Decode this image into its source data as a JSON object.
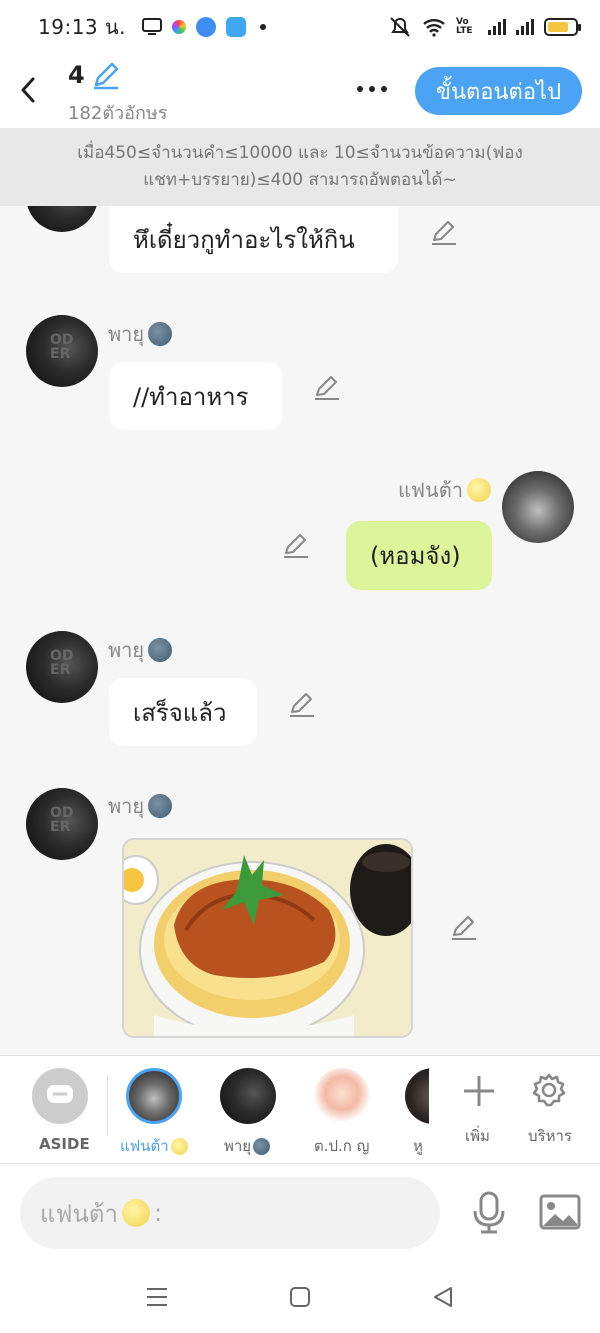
{
  "status_bar": {
    "time": "19:13 น.",
    "network_label": "Vo LTE",
    "battery_level": 0.75
  },
  "header": {
    "title": "4",
    "char_count": "182ตัวอักษร",
    "next_label": "ขั้นตอนต่อไป"
  },
  "notice": {
    "text": "เมื่อ450≤จำนวนคำ≤10000 และ 10≤จำนวนข้อความ(ฟองแชท+บรรยาย)≤400 สามารถอัพตอนได้~"
  },
  "messages": [
    {
      "speaker": "",
      "side": "left",
      "text": "หึเดี๋ยวกูทำอะไรให้กิน"
    },
    {
      "speaker": "พายุ",
      "side": "left",
      "text": "//ทำอาหาร"
    },
    {
      "speaker": "แฟนต้า",
      "side": "right",
      "text": "(หอมจัง)"
    },
    {
      "speaker": "พายุ",
      "side": "left",
      "text": "เสร็จแล้ว"
    },
    {
      "speaker": "พายุ",
      "side": "left",
      "text": "",
      "image": "katsudon-bowl"
    }
  ],
  "roster": {
    "aside_label": "ASIDE",
    "characters": [
      {
        "name": "แฟนต้า",
        "selected": true
      },
      {
        "name": "พายุ",
        "selected": false
      },
      {
        "name": "ต.ป.ก ญ",
        "selected": false
      },
      {
        "name": "หู",
        "selected": false
      }
    ],
    "add_label": "เพิ่ม",
    "manage_label": "บริหาร"
  },
  "input": {
    "placeholder": "แฟนต้า",
    "suffix": ":"
  },
  "colors": {
    "accent": "#4aa3f5",
    "my_bubble": "#dcf59a",
    "other_bubble": "#ffffff"
  }
}
